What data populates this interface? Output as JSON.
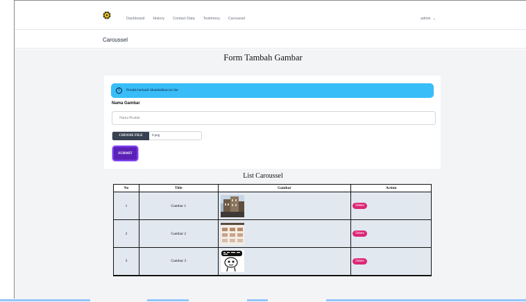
{
  "nav": {
    "links": [
      "Dashboard",
      "History",
      "Contact Data",
      "Testimony",
      "Caroussel"
    ],
    "user": "admin",
    "logo_icon": "gear-sun-icon"
  },
  "page_header": {
    "title": "Caroussel"
  },
  "form": {
    "title": "Form Tambah Gambar",
    "alert": "Produk berhasil ditambahkan ke list",
    "name_label": "Nama Gambar",
    "name_placeholder": "Nama Produk",
    "file_button": "CHOOSE FILE",
    "file_name": "6.png",
    "submit": "SUBMIT"
  },
  "list": {
    "title": "List Caroussel",
    "columns": [
      "No",
      "Title",
      "Gambar",
      "Action"
    ],
    "rows": [
      {
        "no": "1",
        "title": "Gambar 1",
        "image": "building-photo",
        "action": "Delete"
      },
      {
        "no": "2",
        "title": "Gambar 2",
        "image": "pattern-tiles",
        "action": "Delete"
      },
      {
        "no": "3",
        "title": "Gambar 3",
        "image": "meme-cartoon",
        "action": "Delete"
      }
    ]
  },
  "colors": {
    "accent": "#5b21b6",
    "alert_bg": "#38bdf8",
    "delete_bg": "#db2777"
  }
}
